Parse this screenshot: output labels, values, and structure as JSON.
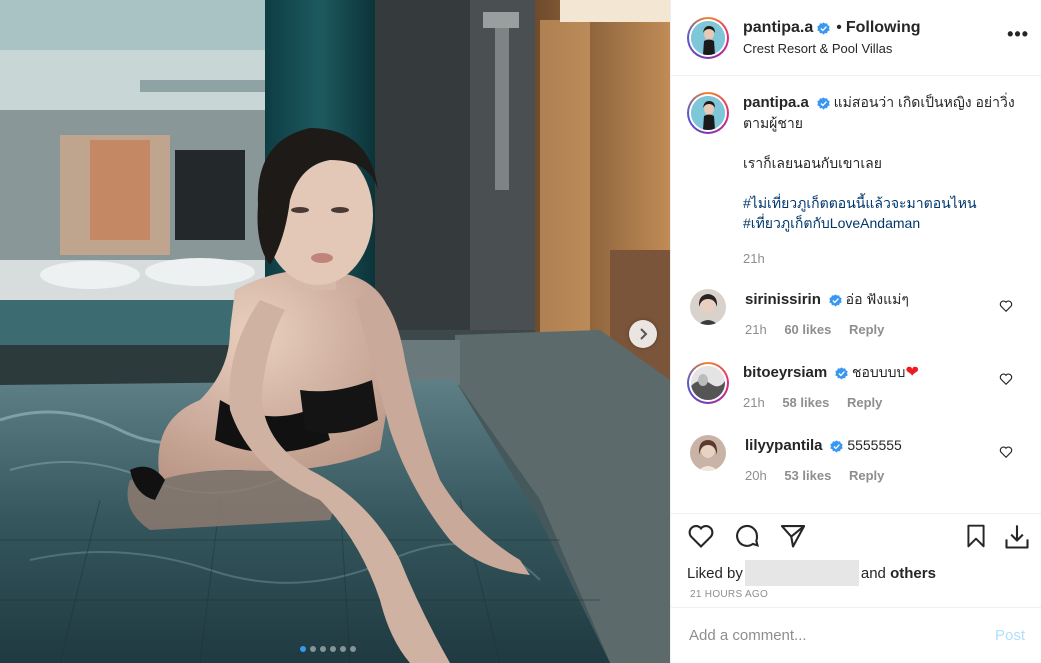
{
  "post": {
    "username": "pantipa.a",
    "follow_separator": "•",
    "follow_label": "Following",
    "location": "Crest Resort & Pool Villas",
    "more_label": "•••"
  },
  "caption": {
    "username": "pantipa.a",
    "line1": "แม่สอนว่า เกิดเป็นหญิง อย่าวิ่งตามผู้ชาย",
    "line2": "เราก็เลยนอนกับเขาเลย",
    "hashtags": [
      "#ไม่เที่ยวภูเก็ตตอนนี้แล้วจะมาตอนไหน",
      "#เที่ยวภูเก็ตกับLoveAndaman"
    ],
    "time": "21h"
  },
  "comments": [
    {
      "username": "sirinissirin",
      "text": "อ่อ ฟังแม่ๆ",
      "time": "21h",
      "likes": "60 likes",
      "reply": "Reply"
    },
    {
      "username": "bitoeyrsiam",
      "text": "ชอบบบบ",
      "emoji": "❤",
      "time": "21h",
      "likes": "58 likes",
      "reply": "Reply"
    },
    {
      "username": "lilyypantila",
      "text": "5555555",
      "time": "20h",
      "likes": "53 likes",
      "reply": "Reply"
    }
  ],
  "likes": {
    "prefix": "Liked by",
    "mid": "and",
    "suffix": "others"
  },
  "time_ago": "21 HOURS AGO",
  "add_comment": {
    "placeholder": "Add a comment...",
    "post_label": "Post"
  },
  "carousel": {
    "dot_count": 6,
    "active_index": 0
  },
  "colors": {
    "link": "#00376b",
    "verified": "#3897f0",
    "muted": "#8e8e8e",
    "post_disabled": "#b2dffc",
    "heart_emoji": "#ed1c24"
  },
  "icons": [
    "verified-badge-icon",
    "more-options-icon",
    "next-arrow-icon",
    "heart-icon",
    "comment-icon",
    "share-icon",
    "bookmark-icon",
    "download-icon"
  ]
}
